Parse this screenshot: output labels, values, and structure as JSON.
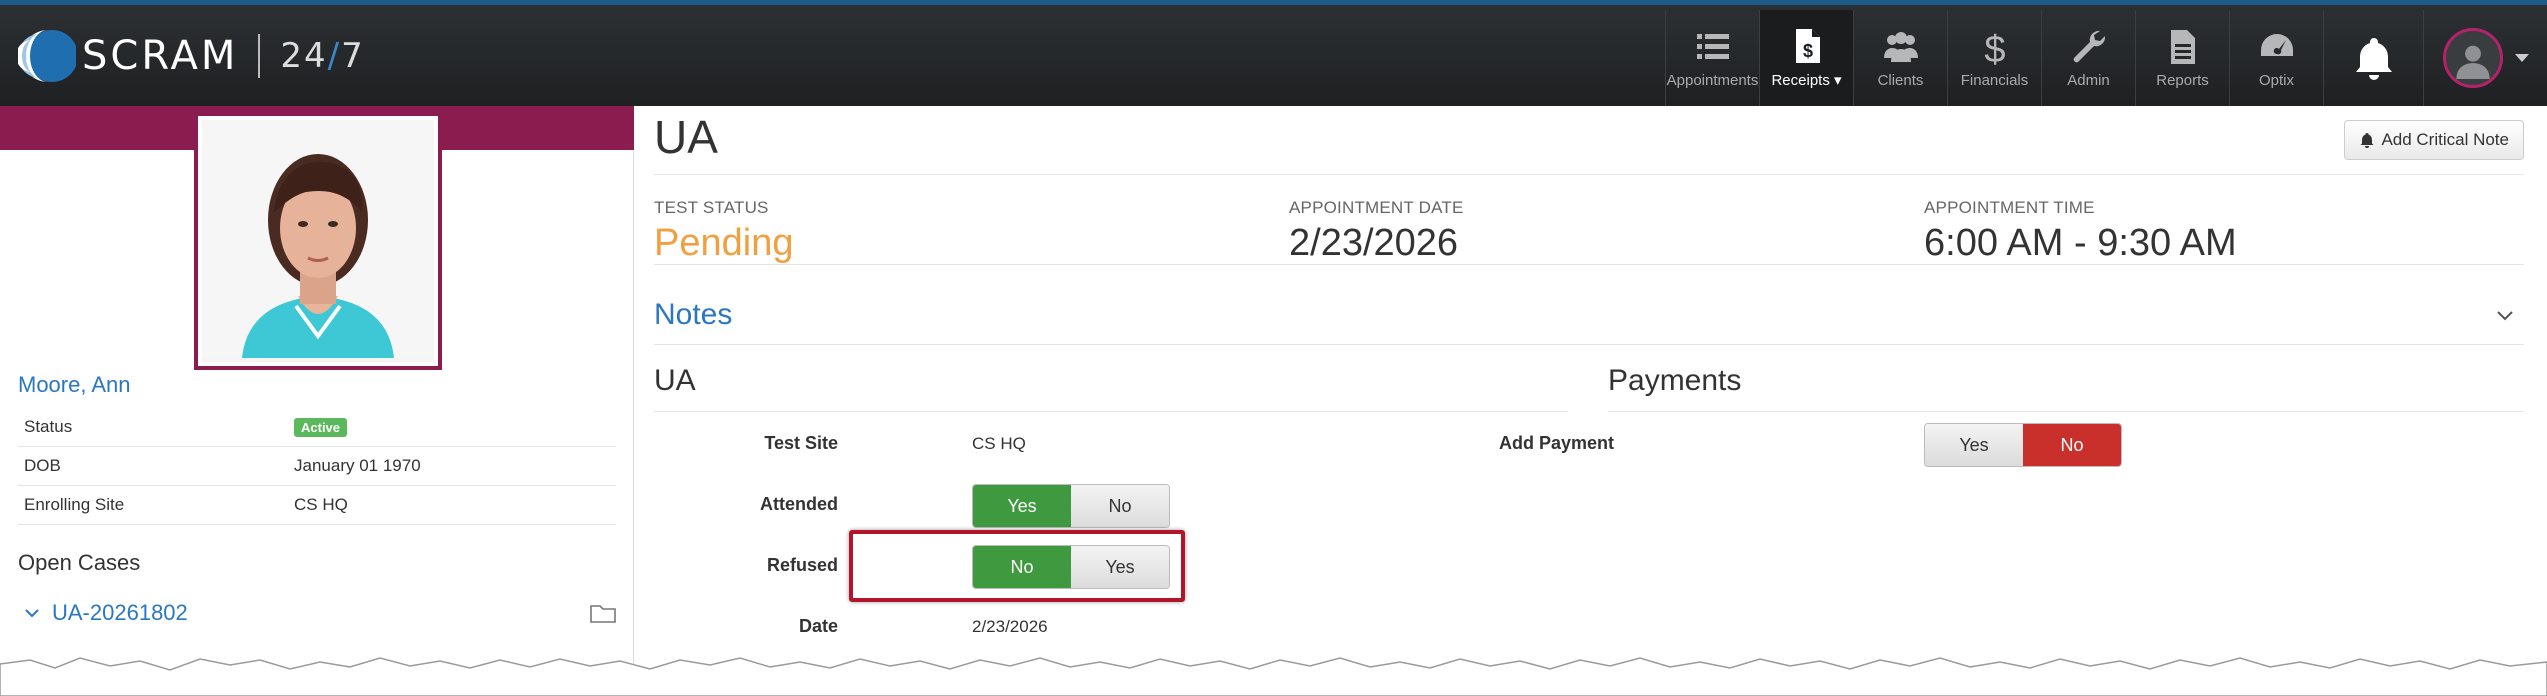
{
  "brand": {
    "name": "SCRAM",
    "suffix_left": "24",
    "suffix_slash": "/",
    "suffix_right": "7"
  },
  "nav": {
    "items": [
      {
        "label": "Appointments",
        "icon": "list-icon"
      },
      {
        "label": "Receipts",
        "icon": "receipt-icon",
        "active": true
      },
      {
        "label": "Clients",
        "icon": "users-icon"
      },
      {
        "label": "Financials",
        "icon": "dollar-icon"
      },
      {
        "label": "Admin",
        "icon": "wrench-icon"
      },
      {
        "label": "Reports",
        "icon": "document-icon"
      },
      {
        "label": "Optix",
        "icon": "gauge-icon"
      }
    ]
  },
  "client": {
    "name": "Moore, Ann",
    "status_label": "Status",
    "status_value": "Active",
    "dob_label": "DOB",
    "dob_value": "January 01 1970",
    "site_label": "Enrolling Site",
    "site_value": "CS HQ",
    "open_cases_title": "Open Cases",
    "case_id": "UA-20261802"
  },
  "main": {
    "title": "UA",
    "critical_note_label": "Add Critical Note",
    "test_status_label": "TEST STATUS",
    "test_status_value": "Pending",
    "appt_date_label": "APPOINTMENT DATE",
    "appt_date_value": "2/23/2026",
    "appt_time_label": "APPOINTMENT TIME",
    "appt_time_value": "6:00 AM - 9:30 AM",
    "notes_title": "Notes"
  },
  "ua_section": {
    "title": "UA",
    "test_site_label": "Test Site",
    "test_site_value": "CS HQ",
    "attended_label": "Attended",
    "attended_yes": "Yes",
    "attended_no": "No",
    "refused_label": "Refused",
    "refused_no": "No",
    "refused_yes": "Yes",
    "date_label": "Date",
    "date_value": "2/23/2026"
  },
  "payments_section": {
    "title": "Payments",
    "add_payment_label": "Add Payment",
    "yes": "Yes",
    "no": "No"
  },
  "colors": {
    "accent_maroon": "#8b1c4f",
    "link_blue": "#2b77c0",
    "pending_orange": "#f0a040",
    "toggle_green": "#3f9a3f",
    "toggle_red": "#c9302c",
    "highlight_red": "#b0152a"
  }
}
